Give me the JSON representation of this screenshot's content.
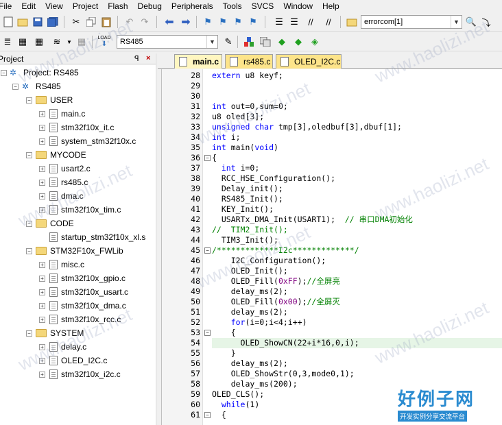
{
  "menu": [
    "File",
    "Edit",
    "View",
    "Project",
    "Flash",
    "Debug",
    "Peripherals",
    "Tools",
    "SVCS",
    "Window",
    "Help"
  ],
  "toolbar": {
    "find_combo": "errorcom[1]",
    "target_combo": "RS485",
    "load_label": "LOAD"
  },
  "project_panel": {
    "title": "Project",
    "pin": "ꟼ",
    "close": "×"
  },
  "tree": [
    {
      "label": "Project: RS485",
      "type": "root"
    },
    {
      "label": "RS485",
      "type": "target"
    },
    {
      "label": "USER",
      "type": "group"
    },
    {
      "label": "main.c",
      "type": "file"
    },
    {
      "label": "stm32f10x_it.c",
      "type": "file"
    },
    {
      "label": "system_stm32f10x.c",
      "type": "file"
    },
    {
      "label": "MYCODE",
      "type": "group"
    },
    {
      "label": "usart2.c",
      "type": "file"
    },
    {
      "label": "rs485.c",
      "type": "file"
    },
    {
      "label": "dma.c",
      "type": "file"
    },
    {
      "label": "stm32f10x_tim.c",
      "type": "file"
    },
    {
      "label": "CODE",
      "type": "group"
    },
    {
      "label": "startup_stm32f10x_xl.s",
      "type": "file"
    },
    {
      "label": "STM32F10x_FWLib",
      "type": "group"
    },
    {
      "label": "misc.c",
      "type": "file"
    },
    {
      "label": "stm32f10x_gpio.c",
      "type": "file"
    },
    {
      "label": "stm32f10x_usart.c",
      "type": "file"
    },
    {
      "label": "stm32f10x_dma.c",
      "type": "file"
    },
    {
      "label": "stm32f10x_rcc.c",
      "type": "file"
    },
    {
      "label": "SYSTEM",
      "type": "group"
    },
    {
      "label": "delay.c",
      "type": "file"
    },
    {
      "label": "OLED_I2C.c",
      "type": "file"
    },
    {
      "label": "stm32f10x_i2c.c",
      "type": "file"
    }
  ],
  "tabs": [
    {
      "label": "main.c",
      "active": true,
      "color": "#fff6c0"
    },
    {
      "label": "rs485.c",
      "active": false,
      "color": "#fde48a"
    },
    {
      "label": "OLED_I2C.c",
      "active": false,
      "color": "#fde48a"
    }
  ],
  "code_lines": [
    {
      "n": "28",
      "t": "extern u8 keyf;"
    },
    {
      "n": "29",
      "t": ""
    },
    {
      "n": "30",
      "t": ""
    },
    {
      "n": "31",
      "t": "int out=0,sum=0;"
    },
    {
      "n": "32",
      "t": "u8 oled[3];"
    },
    {
      "n": "33",
      "t": "unsigned char tmp[3],oledbuf[3],dbuf[1];"
    },
    {
      "n": "34",
      "t": "int i;"
    },
    {
      "n": "35",
      "t": "int main(void)"
    },
    {
      "n": "36",
      "t": "{",
      "fold": "−"
    },
    {
      "n": "37",
      "t": "  int i=0;"
    },
    {
      "n": "38",
      "t": "  RCC_HSE_Configuration();"
    },
    {
      "n": "39",
      "t": "  Delay_init();"
    },
    {
      "n": "40",
      "t": "  RS485_Init();"
    },
    {
      "n": "41",
      "t": "  KEY_Init();"
    },
    {
      "n": "42",
      "t": "  USARTx_DMA_Init(USART1);  // 串口DMA初始化"
    },
    {
      "n": "43",
      "t": "//  TIM2_Init();"
    },
    {
      "n": "44",
      "t": "  TIM3_Init();"
    },
    {
      "n": "45",
      "t": "/*************I2c*************/",
      "fold": "−"
    },
    {
      "n": "46",
      "t": "    I2C_Configuration();"
    },
    {
      "n": "47",
      "t": "    OLED_Init();"
    },
    {
      "n": "48",
      "t": "    OLED_Fill(0xFF);//全屏亮"
    },
    {
      "n": "49",
      "t": "    delay_ms(2);"
    },
    {
      "n": "50",
      "t": "    OLED_Fill(0x00);//全屏灭"
    },
    {
      "n": "51",
      "t": "    delay_ms(2);"
    },
    {
      "n": "52",
      "t": "    for(i=0;i<4;i++)"
    },
    {
      "n": "53",
      "t": "    {",
      "fold": "−"
    },
    {
      "n": "54",
      "t": "      OLED_ShowCN(22+i*16,0,i);",
      "hl": true
    },
    {
      "n": "55",
      "t": "    }"
    },
    {
      "n": "56",
      "t": "    delay_ms(2);"
    },
    {
      "n": "57",
      "t": "    OLED_ShowStr(0,3,mode0,1);"
    },
    {
      "n": "58",
      "t": "    delay_ms(200);"
    },
    {
      "n": "59",
      "t": "OLED_CLS();"
    },
    {
      "n": "60",
      "t": "  while(1)"
    },
    {
      "n": "61",
      "t": "  {",
      "fold": "−"
    }
  ],
  "watermark": "www.haolizi.net",
  "logo": {
    "title": "好例子网",
    "subtitle": "开发实例分享交流平台"
  }
}
